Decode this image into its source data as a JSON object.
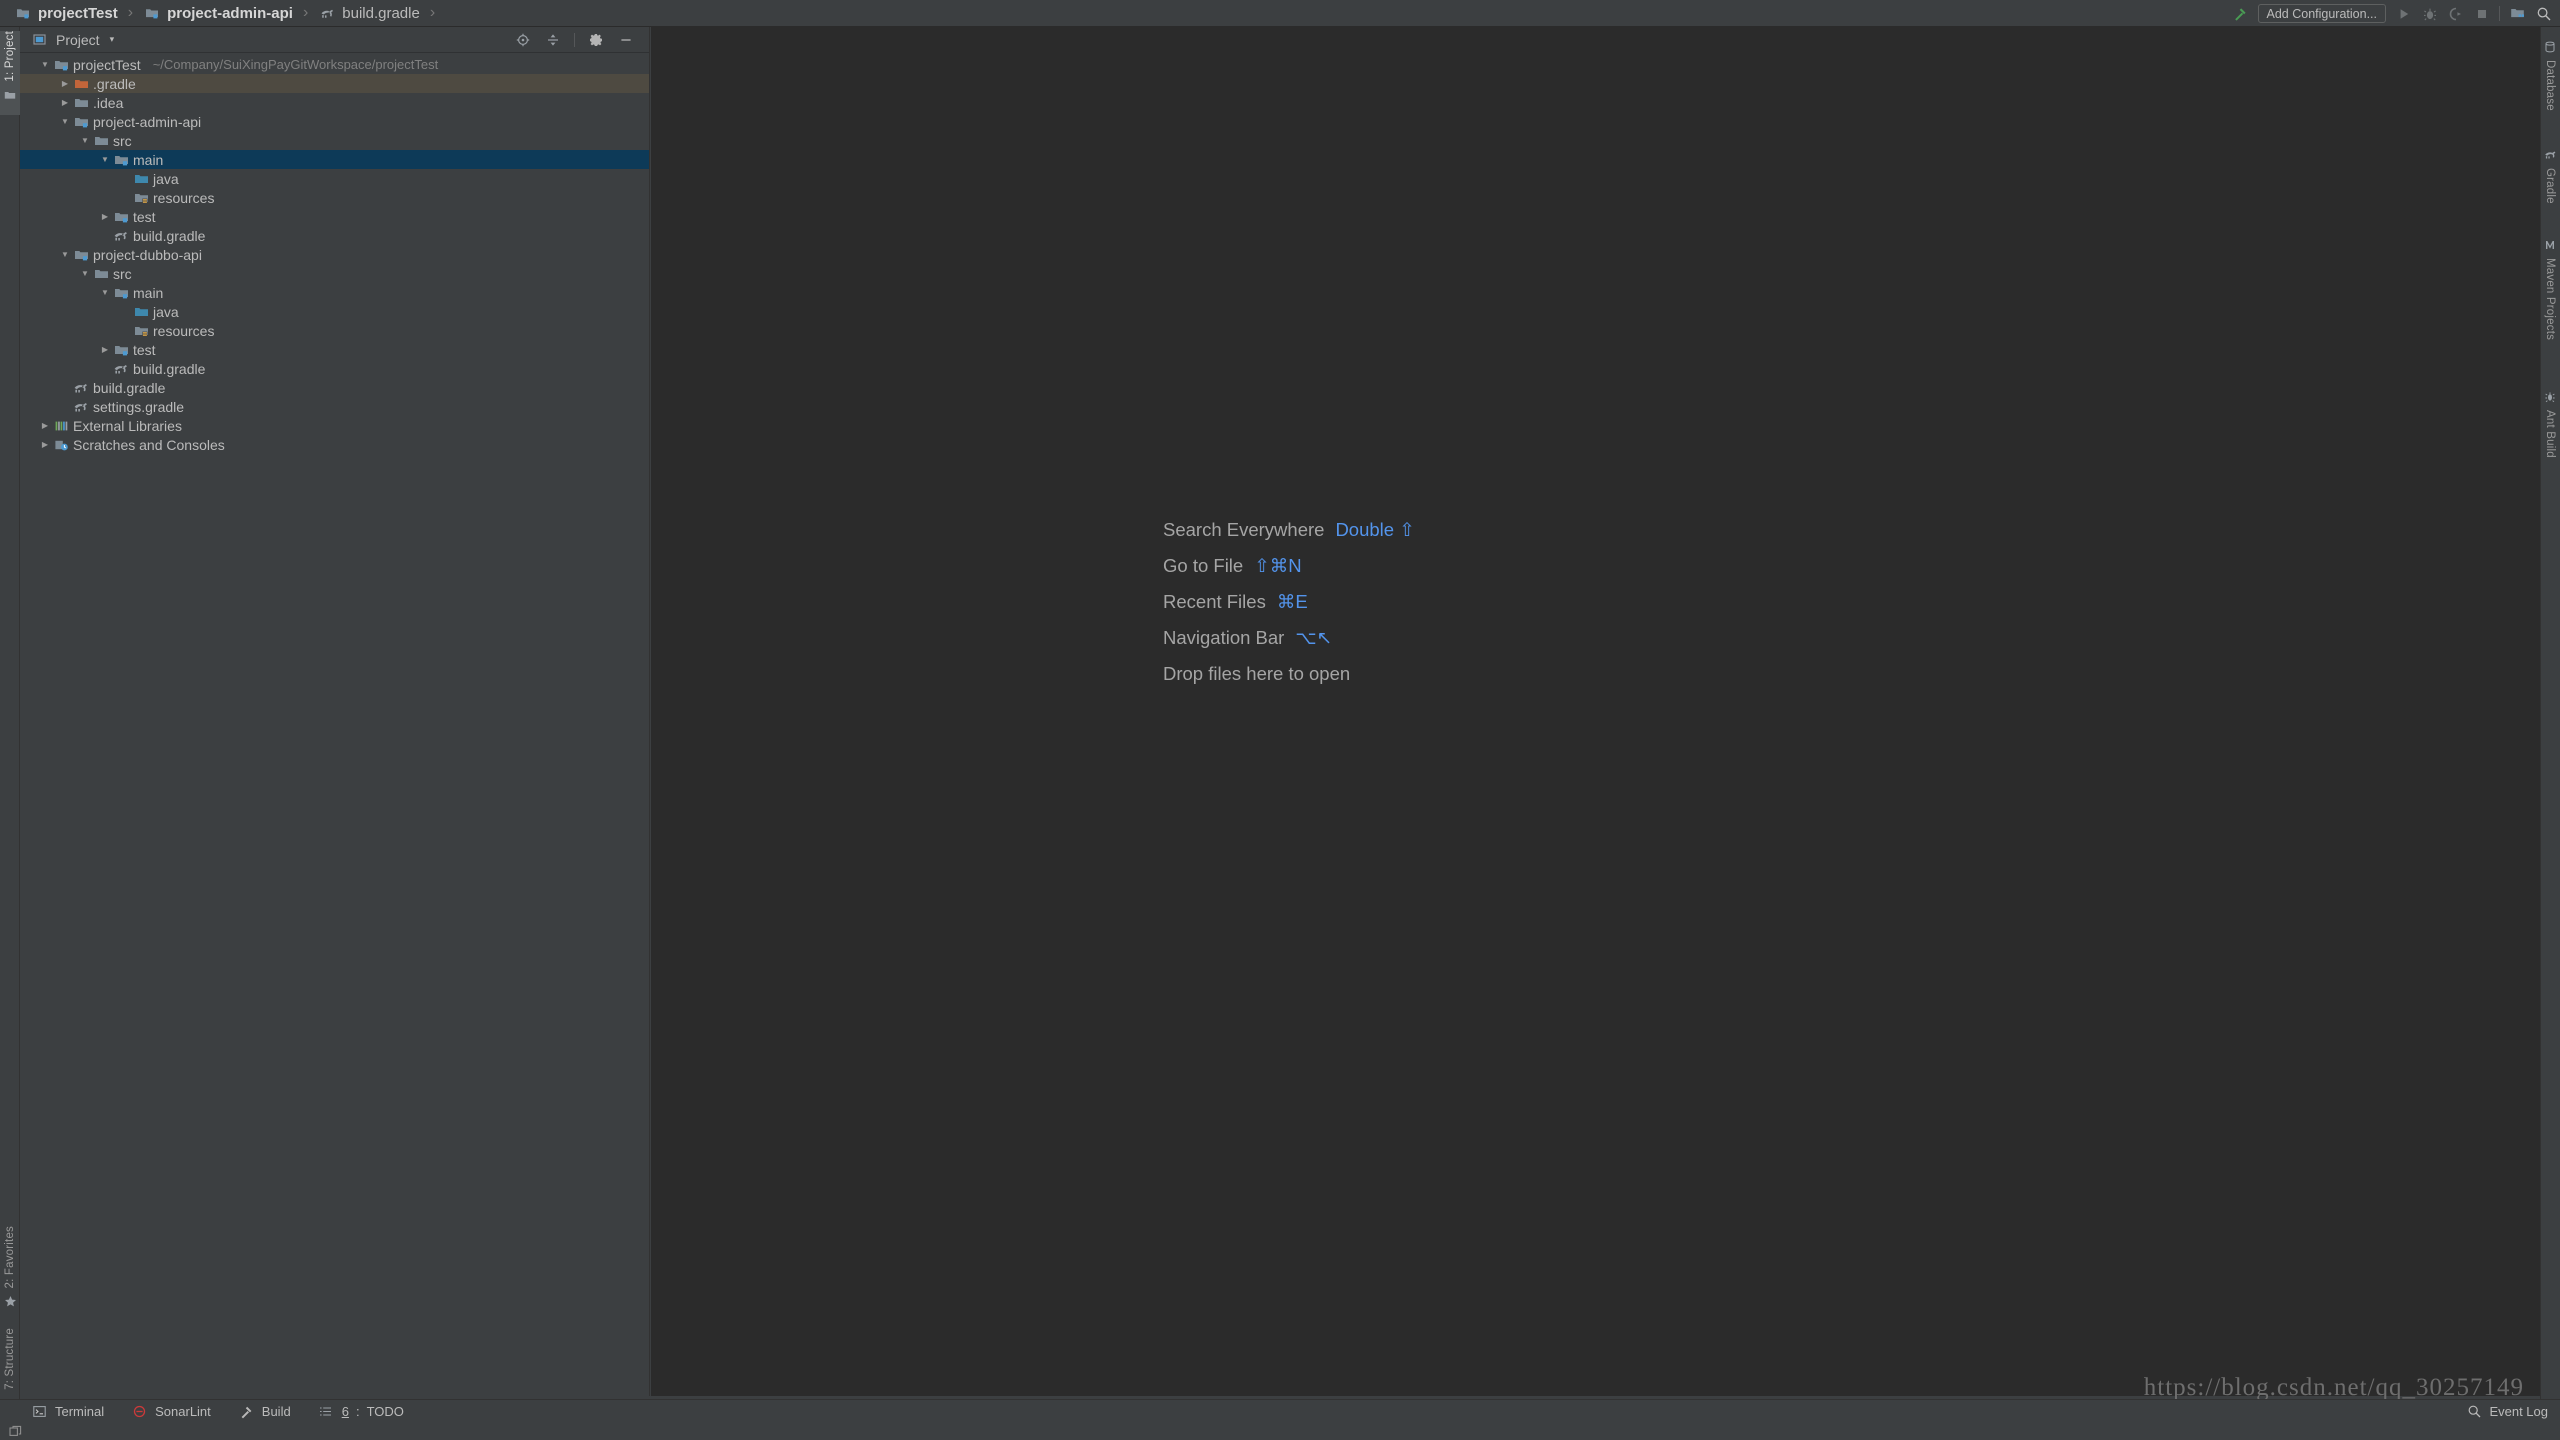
{
  "window": {
    "theme_bg": "#3c3f41",
    "editor_bg": "#2b2b2b",
    "accent_blue": "#5394ec",
    "selection_bg": "#0d3a58"
  },
  "navbar": {
    "crumbs": [
      {
        "label": "projectTest",
        "icon": "module-folder-icon",
        "bold": true
      },
      {
        "label": "project-admin-api",
        "icon": "module-folder-icon",
        "bold": true
      },
      {
        "label": "build.gradle",
        "icon": "gradle-elephant-icon",
        "bold": false
      }
    ],
    "separator": "›"
  },
  "run_toolbar": {
    "hammer_icon": "build-hammer-icon",
    "add_configuration_label": "Add Configuration...",
    "run_icon": "run-play-icon",
    "debug_icon": "debug-bug-icon",
    "coverage_icon": "run-with-coverage-icon",
    "stop_icon": "stop-square-icon",
    "project_structure_icon": "project-structure-icon",
    "search_icon": "search-icon"
  },
  "left_stripe": {
    "top": [
      {
        "label": "1: Project",
        "icon": "project-window-icon",
        "active": true
      }
    ],
    "bottom": [
      {
        "label": "2: Favorites",
        "icon": "star-icon"
      },
      {
        "label": "7: Structure",
        "icon": "structure-icon"
      }
    ]
  },
  "right_stripe": {
    "items": [
      {
        "label": "Database",
        "icon": "database-icon"
      },
      {
        "label": "Gradle",
        "icon": "gradle-elephant-icon"
      },
      {
        "label": "Maven Projects",
        "icon": "maven-icon"
      },
      {
        "label": "Ant Build",
        "icon": "ant-icon"
      }
    ]
  },
  "project_panel": {
    "title": "Project",
    "title_icon": "project-window-icon",
    "caret": "▾",
    "actions": [
      {
        "name": "select-opened-file-icon",
        "label": "Select Opened File"
      },
      {
        "name": "collapse-all-icon",
        "label": "Collapse All"
      },
      {
        "name": "gear-icon",
        "label": "Settings"
      },
      {
        "name": "hide-icon",
        "label": "Hide"
      }
    ],
    "tree": [
      {
        "id": 0,
        "label": "projectTest",
        "path": "~/Company/SuiXingPayGitWorkspace/projectTest",
        "depth": 0,
        "twisty": "expanded",
        "icon": "module-folder-icon",
        "state": "normal"
      },
      {
        "id": 1,
        "label": ".gradle",
        "path": "",
        "depth": 1,
        "twisty": "collapsed",
        "icon": "excluded-folder-icon",
        "state": "hovered"
      },
      {
        "id": 2,
        "label": ".idea",
        "path": "",
        "depth": 1,
        "twisty": "collapsed",
        "icon": "plain-folder-icon",
        "state": "normal"
      },
      {
        "id": 3,
        "label": "project-admin-api",
        "path": "",
        "depth": 1,
        "twisty": "expanded",
        "icon": "module-folder-icon",
        "state": "normal"
      },
      {
        "id": 4,
        "label": "src",
        "path": "",
        "depth": 2,
        "twisty": "expanded",
        "icon": "plain-folder-icon",
        "state": "normal"
      },
      {
        "id": 5,
        "label": "main",
        "path": "",
        "depth": 3,
        "twisty": "expanded",
        "icon": "module-folder-icon",
        "state": "selected"
      },
      {
        "id": 6,
        "label": "java",
        "path": "",
        "depth": 4,
        "twisty": "none",
        "icon": "source-folder-icon",
        "state": "normal"
      },
      {
        "id": 7,
        "label": "resources",
        "path": "",
        "depth": 4,
        "twisty": "none",
        "icon": "resource-folder-icon",
        "state": "normal"
      },
      {
        "id": 8,
        "label": "test",
        "path": "",
        "depth": 3,
        "twisty": "collapsed",
        "icon": "module-folder-icon",
        "state": "normal"
      },
      {
        "id": 9,
        "label": "build.gradle",
        "path": "",
        "depth": 3,
        "twisty": "none",
        "icon": "gradle-elephant-icon",
        "state": "normal"
      },
      {
        "id": 10,
        "label": "project-dubbo-api",
        "path": "",
        "depth": 1,
        "twisty": "expanded",
        "icon": "module-folder-icon",
        "state": "normal"
      },
      {
        "id": 11,
        "label": "src",
        "path": "",
        "depth": 2,
        "twisty": "expanded",
        "icon": "plain-folder-icon",
        "state": "normal"
      },
      {
        "id": 12,
        "label": "main",
        "path": "",
        "depth": 3,
        "twisty": "expanded",
        "icon": "module-folder-icon",
        "state": "normal"
      },
      {
        "id": 13,
        "label": "java",
        "path": "",
        "depth": 4,
        "twisty": "none",
        "icon": "source-folder-icon",
        "state": "normal"
      },
      {
        "id": 14,
        "label": "resources",
        "path": "",
        "depth": 4,
        "twisty": "none",
        "icon": "resource-folder-icon",
        "state": "normal"
      },
      {
        "id": 15,
        "label": "test",
        "path": "",
        "depth": 3,
        "twisty": "collapsed",
        "icon": "module-folder-icon",
        "state": "normal"
      },
      {
        "id": 16,
        "label": "build.gradle",
        "path": "",
        "depth": 3,
        "twisty": "none",
        "icon": "gradle-elephant-icon",
        "state": "normal"
      },
      {
        "id": 17,
        "label": "build.gradle",
        "path": "",
        "depth": 1,
        "twisty": "none",
        "icon": "gradle-elephant-icon",
        "state": "normal"
      },
      {
        "id": 18,
        "label": "settings.gradle",
        "path": "",
        "depth": 1,
        "twisty": "none",
        "icon": "gradle-elephant-icon",
        "state": "normal"
      },
      {
        "id": 19,
        "label": "External Libraries",
        "path": "",
        "depth": 0,
        "twisty": "collapsed",
        "icon": "libraries-icon",
        "state": "normal"
      },
      {
        "id": 20,
        "label": "Scratches and Consoles",
        "path": "",
        "depth": 0,
        "twisty": "collapsed",
        "icon": "scratches-icon",
        "state": "normal"
      }
    ]
  },
  "editor": {
    "hints": [
      {
        "label": "Search Everywhere",
        "key": "Double ⇧"
      },
      {
        "label": "Go to File",
        "key": "⇧⌘N"
      },
      {
        "label": "Recent Files",
        "key": "⌘E"
      },
      {
        "label": "Navigation Bar",
        "key": "⌥↖"
      },
      {
        "label": "Drop files here to open",
        "key": ""
      }
    ],
    "watermark": "https://blog.csdn.net/qq_30257149"
  },
  "bottom_bar": {
    "items": [
      {
        "label": "Terminal",
        "icon": "terminal-icon",
        "prefix": ""
      },
      {
        "label": "SonarLint",
        "icon": "sonarlint-icon",
        "prefix": ""
      },
      {
        "label": "Build",
        "icon": "build-hammer-icon",
        "prefix": ""
      },
      {
        "label": "TODO",
        "icon": "todo-list-icon",
        "prefix": "6"
      }
    ],
    "event_log": {
      "label": "Event Log",
      "icon": "event-log-icon"
    }
  }
}
